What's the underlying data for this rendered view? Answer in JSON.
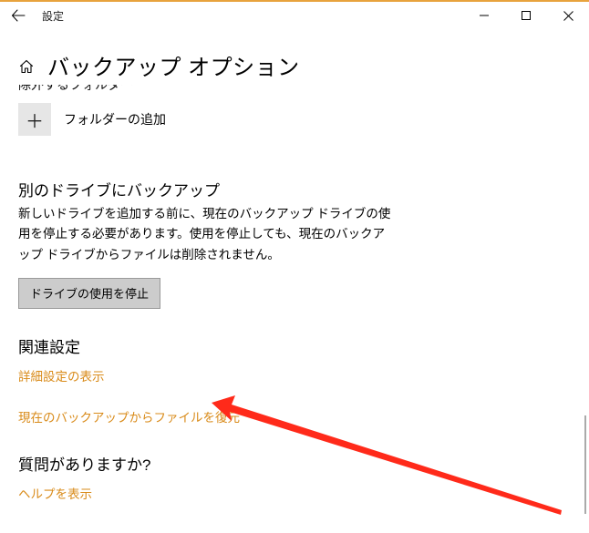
{
  "titlebar": {
    "title": "設定"
  },
  "header": {
    "page_title": "バックアップ オプション"
  },
  "content": {
    "cutoff_text": "除外するフォルダー",
    "add_folder_label": "フォルダーの追加",
    "section_other_drive": {
      "title": "別のドライブにバックアップ",
      "body": "新しいドライブを追加する前に、現在のバックアップ ドライブの使用を停止する必要があります。使用を停止しても、現在のバックアップ ドライブからファイルは削除されません。",
      "stop_button": "ドライブの使用を停止"
    },
    "section_related": {
      "title": "関連設定",
      "link_advanced": "詳細設定の表示",
      "link_restore": "現在のバックアップからファイルを復元"
    },
    "section_question": {
      "title": "質問がありますか?",
      "link_help": "ヘルプを表示"
    }
  }
}
